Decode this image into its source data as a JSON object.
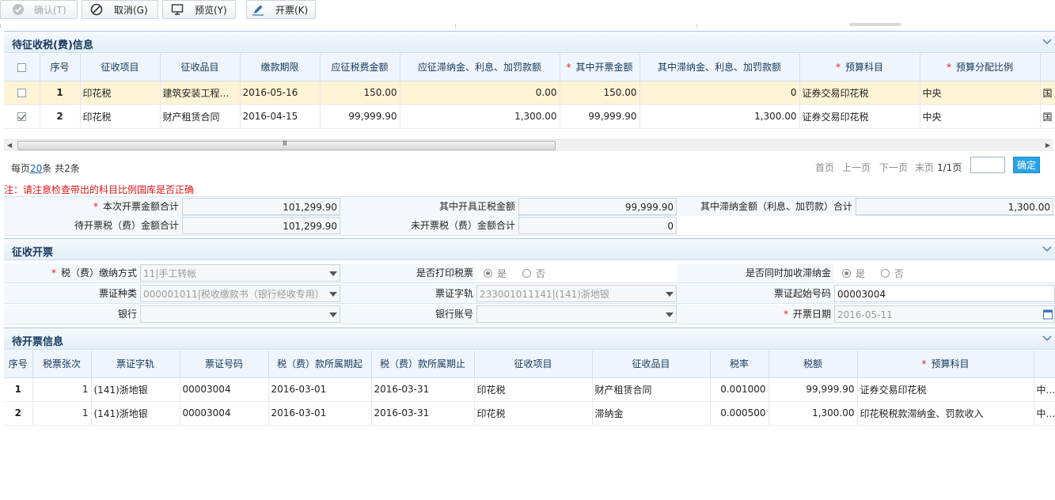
{
  "toolbar": {
    "confirm": "确认(T)",
    "cancel": "取消(G)",
    "preview": "预览(Y)",
    "invoice": "开票(K)"
  },
  "pending": {
    "title": "待征收税(费)信息",
    "headers": [
      "序号",
      "征收项目",
      "征收品目",
      "缴款期限",
      "应征税费金额",
      "应征滞纳金、利息、加罚款额",
      "其中开票金额",
      "其中滞纳金、利息、加罚款额",
      "预算科目",
      "预算分配比例"
    ],
    "rows": [
      {
        "checked": false,
        "no": "1",
        "item": "印花税",
        "sub": "建筑安装工程承...",
        "deadline": "2016-05-16",
        "amount": "150.00",
        "late": "0.00",
        "invoice_amount": "150.00",
        "late_in": "0",
        "budget": "证券交易印花税",
        "ratio": "中央",
        "extra": "国"
      },
      {
        "checked": true,
        "no": "2",
        "item": "印花税",
        "sub": "财产租赁合同",
        "deadline": "2016-04-15",
        "amount": "99,999.90",
        "late": "1,300.00",
        "invoice_amount": "99,999.90",
        "late_in": "1,300.00",
        "budget": "证券交易印花税",
        "ratio": "中央",
        "extra": "国"
      }
    ],
    "scroll_grip": "III"
  },
  "pager": {
    "per_page_prefix": "每页",
    "per_page": "20",
    "per_page_suffix": "条 共2条",
    "first": "首页",
    "prev": "上一页",
    "next": "下一页",
    "last": "末页",
    "page": "1/1页",
    "go": "确定"
  },
  "note": "注：请注意检查带出的科目比例国库是否正确",
  "totals": {
    "this_invoice_label": "本次开票金额合计",
    "this_invoice_value": "101,299.90",
    "tax_label": "其中开具正税金额",
    "tax_value": "99,999.90",
    "late_label": "其中滞纳金额（利息、加罚款）合计",
    "late_value": "1,300.00",
    "pending_label": "待开票税（费）金额合计",
    "pending_value": "101,299.90",
    "unissued_label": "未开票税（费）金额合计",
    "unissued_value": "0"
  },
  "issue": {
    "title": "征收开票",
    "pay_method_label": "税（费）缴纳方式",
    "pay_method_value": "11|手工转帐",
    "print_label": "是否打印税票",
    "yes": "是",
    "no": "否",
    "late_label": "是否同时加收滞纳金",
    "ticket_type_label": "票证种类",
    "ticket_type_value": "000001011|税收缴款书（银行经收专用）",
    "ticket_track_label": "票证字轨",
    "ticket_track_value": "233001011141|(141)浙地银",
    "start_no_label": "票证起始号码",
    "start_no_value": "00003004",
    "bank_label": "银行",
    "bank_value": "",
    "account_label": "银行账号",
    "account_value": "",
    "date_label": "开票日期",
    "date_value": "2016-05-11"
  },
  "todo": {
    "title": "待开票信息",
    "headers": [
      "序号",
      "税票张次",
      "票证字轨",
      "票证号码",
      "税（费）款所属期起",
      "税（费）款所属期止",
      "征收项目",
      "征收品目",
      "税率",
      "税额",
      "预算科目"
    ],
    "rows": [
      {
        "no": "1",
        "count": "1",
        "track": "(141)浙地银",
        "ticket": "00003004",
        "from": "2016-03-01",
        "to": "2016-03-31",
        "item": "印花税",
        "sub": "财产租赁合同",
        "rate": "0.001000",
        "tax": "99,999.90",
        "budget": "证券交易印花税",
        "extra": "中央"
      },
      {
        "no": "2",
        "count": "1",
        "track": "(141)浙地银",
        "ticket": "00003004",
        "from": "2016-03-01",
        "to": "2016-03-31",
        "item": "印花税",
        "sub": "滞纳金",
        "rate": "0.000500",
        "tax": "1,300.00",
        "budget": "印花税税款滞纳金、罚款收入",
        "extra": "中央"
      }
    ]
  },
  "colors": {
    "accent": "#2aa3e6",
    "header_bg": "#eef5fc",
    "selected_row": "#fdf3d5",
    "required": "#e02020"
  },
  "icons": [
    "check-circle-icon",
    "cancel-icon",
    "monitor-icon",
    "pencil-icon",
    "chevron-down-icon",
    "calendar-icon"
  ]
}
